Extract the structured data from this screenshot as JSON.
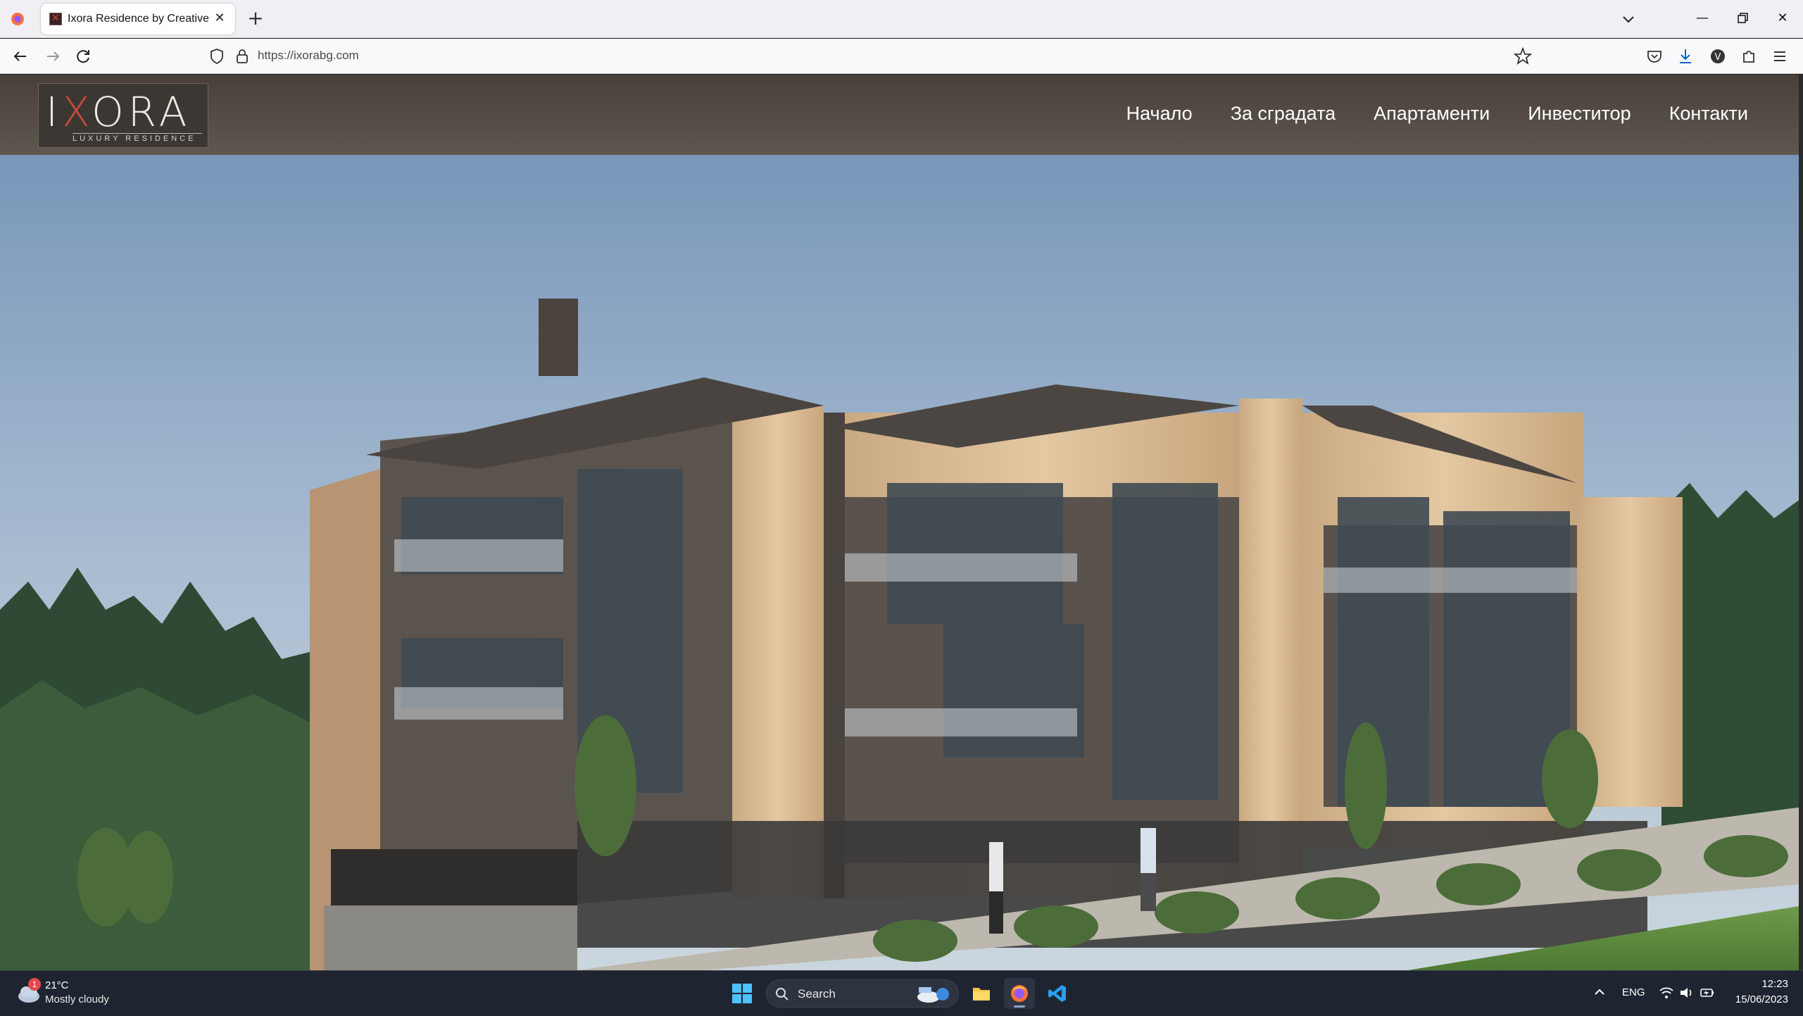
{
  "browser": {
    "tab_title": "Ixora Residence by Creative Studio",
    "url": "https://ixorabg.com"
  },
  "site": {
    "logo_word_a": "I",
    "logo_word_x": "X",
    "logo_word_b": "ORA",
    "logo_sub": "LUXURY RESIDENCE",
    "nav": [
      "Начало",
      "За сградата",
      "Апартаменти",
      "Инвеститор",
      "Контакти"
    ]
  },
  "taskbar": {
    "weather_badge": "1",
    "weather_temp": "21°C",
    "weather_desc": "Mostly cloudy",
    "search_label": "Search",
    "lang": "ENG",
    "time": "12:23",
    "date": "15/06/2023"
  },
  "colors": {
    "accent_logo": "#c94a3a",
    "header_bg": "#5c5246",
    "taskbar_bg": "#1f2530"
  }
}
